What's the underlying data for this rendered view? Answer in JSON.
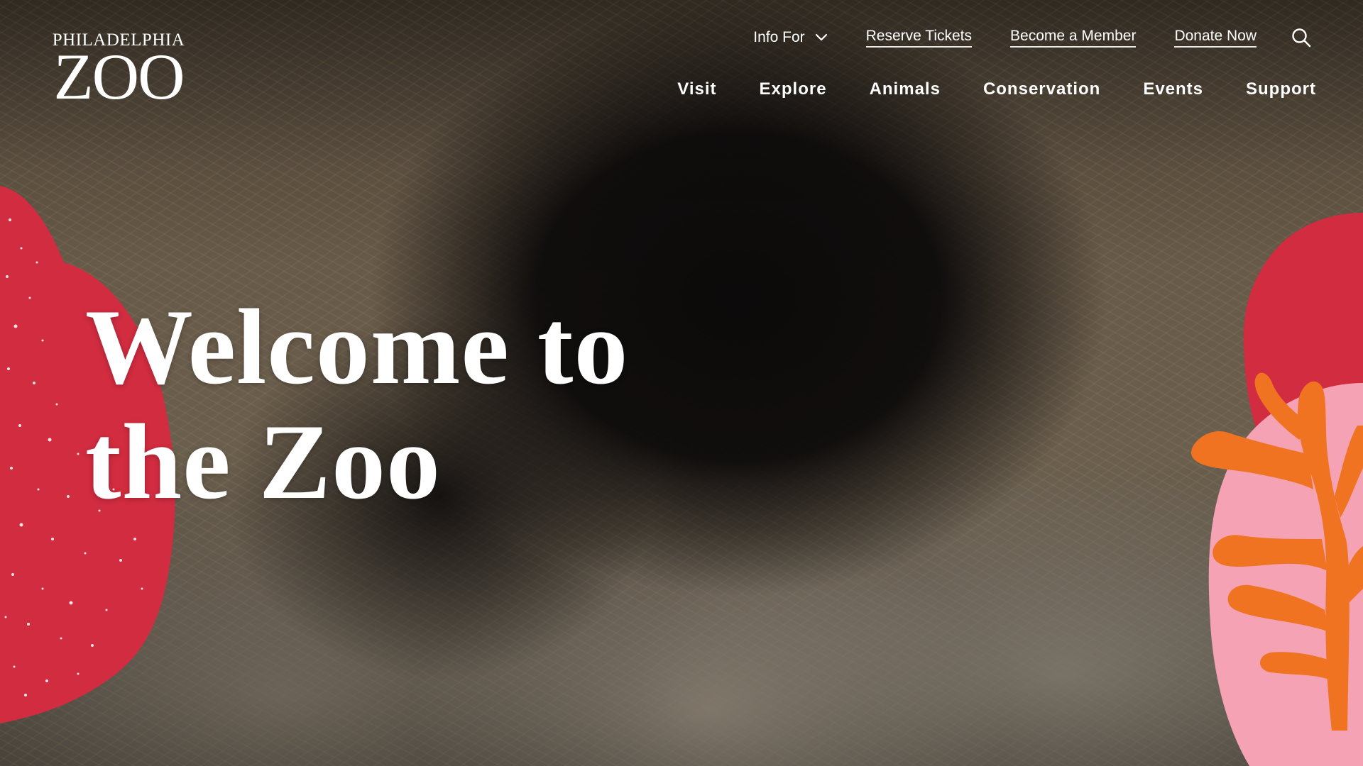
{
  "brand": {
    "logo_top": "PHILADELPHIA",
    "logo_main": "ZOO"
  },
  "util_nav": {
    "info_for": "Info For",
    "reserve_tickets": "Reserve Tickets",
    "become_member": "Become a Member",
    "donate_now": "Donate Now"
  },
  "main_nav": {
    "visit": "Visit",
    "explore": "Explore",
    "animals": "Animals",
    "conservation": "Conservation",
    "events": "Events",
    "support": "Support"
  },
  "hero": {
    "title_line1": "Welcome to",
    "title_line2": "the Zoo"
  },
  "icons": {
    "info_for_chevron": "chevron-down-icon",
    "search": "search-icon"
  },
  "colors": {
    "red_blob": "#d22c40",
    "pink_blob": "#f5a3b4",
    "orange_coral": "#f07322",
    "text": "#ffffff"
  }
}
